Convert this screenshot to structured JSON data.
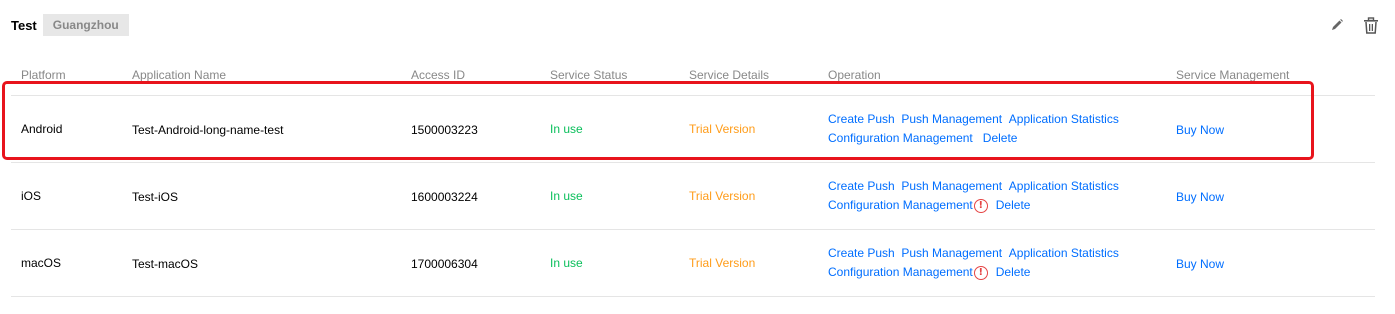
{
  "header": {
    "title": "Test",
    "region": "Guangzhou"
  },
  "columns": [
    "Platform",
    "Application Name",
    "Access ID",
    "Service Status",
    "Service Details",
    "Operation",
    "Service Management"
  ],
  "rows": [
    {
      "platform": "Android",
      "app_name": "Test-Android-long-name-test",
      "access_id": "1500003223",
      "status": "In use",
      "details": "Trial Version",
      "ops": {
        "create_push": "Create Push",
        "push_mgmt": "Push Management",
        "app_stats": "Application Statistics",
        "config_mgmt": "Configuration Management",
        "delete": "Delete"
      },
      "buy": "Buy Now",
      "warning": false
    },
    {
      "platform": "iOS",
      "app_name": "Test-iOS",
      "access_id": "1600003224",
      "status": "In use",
      "details": "Trial Version",
      "ops": {
        "create_push": "Create Push",
        "push_mgmt": "Push Management",
        "app_stats": "Application Statistics",
        "config_mgmt": "Configuration Management",
        "delete": "Delete"
      },
      "buy": "Buy Now",
      "warning": true
    },
    {
      "platform": "macOS",
      "app_name": "Test-macOS",
      "access_id": "1700006304",
      "status": "In use",
      "details": "Trial Version",
      "ops": {
        "create_push": "Create Push",
        "push_mgmt": "Push Management",
        "app_stats": "Application Statistics",
        "config_mgmt": "Configuration Management",
        "delete": "Delete"
      },
      "buy": "Buy Now",
      "warning": true
    }
  ],
  "icons": {
    "edit": "pencil-icon",
    "delete": "trash-icon",
    "warning": "exclamation-circle-icon"
  },
  "colors": {
    "link": "#006eff",
    "status_ok": "#0abf5b",
    "trial": "#ff9c19",
    "warning": "#e54545",
    "highlight": "#e8141c"
  }
}
